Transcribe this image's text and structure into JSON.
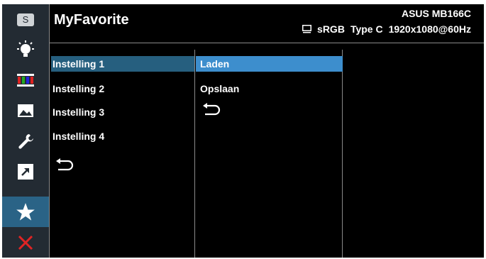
{
  "header": {
    "title": "MyFavorite",
    "model": "ASUS MB166C",
    "color_mode": "sRGB",
    "input": "Type C",
    "resolution": "1920x1080@60Hz"
  },
  "sidebar": {
    "items": [
      {
        "icon": "splendid-icon",
        "label": "S"
      },
      {
        "icon": "blue-light-filter-icon"
      },
      {
        "icon": "color-icon"
      },
      {
        "icon": "image-icon"
      },
      {
        "icon": "system-setup-icon"
      },
      {
        "icon": "shortcut-icon"
      },
      {
        "icon": "my-favorite-star-icon",
        "active": true
      },
      {
        "icon": "exit-x-icon"
      }
    ]
  },
  "menu_level1": {
    "items": [
      "Instelling 1",
      "Instelling 2",
      "Instelling 3",
      "Instelling 4"
    ],
    "selected_index": 0,
    "back_icon": "back-arrow-icon"
  },
  "menu_level2": {
    "items": [
      "Laden",
      "Opslaan"
    ],
    "selected_index": 0,
    "back_icon": "back-arrow-icon"
  },
  "colors": {
    "osd_bg": "#000000",
    "sidebar_bg": "#232b33",
    "sidebar_active": "#2a6386",
    "level1_highlight": "#265f7f",
    "level2_highlight": "#3d8ecd",
    "exit_red": "#e02424",
    "divider": "#8a8a8a"
  }
}
